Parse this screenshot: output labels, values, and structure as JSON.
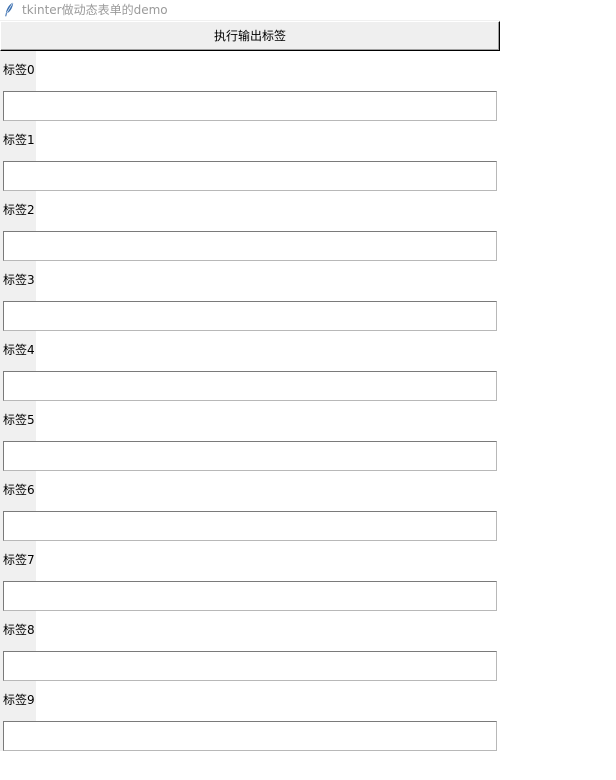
{
  "window": {
    "title": "tkinter做动态表单的demo"
  },
  "toolbar": {
    "run_label": "执行输出标签"
  },
  "form": {
    "rows": [
      {
        "label": "标签0",
        "value": ""
      },
      {
        "label": "标签1",
        "value": ""
      },
      {
        "label": "标签2",
        "value": ""
      },
      {
        "label": "标签3",
        "value": ""
      },
      {
        "label": "标签4",
        "value": ""
      },
      {
        "label": "标签5",
        "value": ""
      },
      {
        "label": "标签6",
        "value": ""
      },
      {
        "label": "标签7",
        "value": ""
      },
      {
        "label": "标签8",
        "value": ""
      },
      {
        "label": "标签9",
        "value": ""
      }
    ]
  }
}
